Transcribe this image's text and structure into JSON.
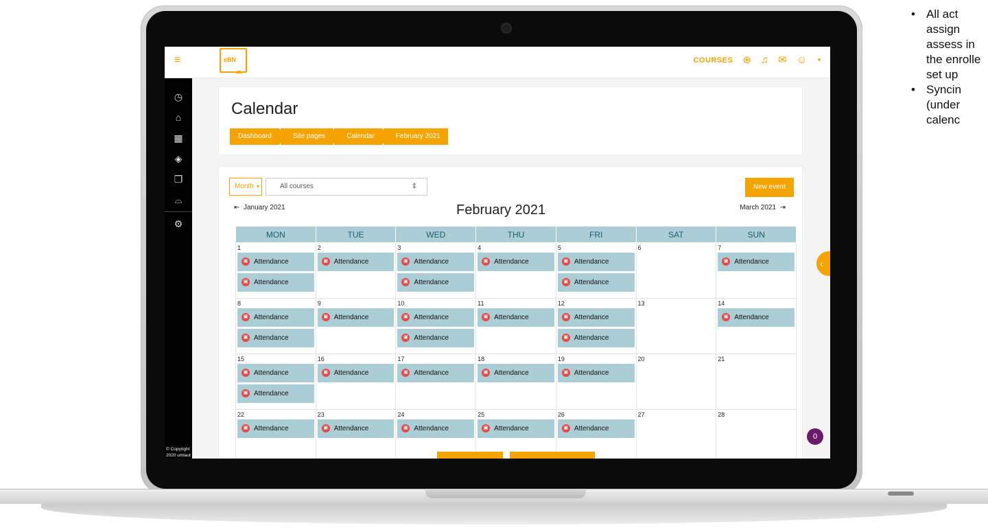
{
  "app": {
    "logo_text": "eBN",
    "top_nav": {
      "courses_label": "COURSES"
    },
    "copyright": "© Copyright 2020 umlaut"
  },
  "page": {
    "title": "Calendar",
    "breadcrumb": [
      "Dashboard",
      "Site pages",
      "Calendar",
      "February 2021"
    ]
  },
  "calendar": {
    "view_select": "Month",
    "course_filter": "All courses",
    "new_event_label": "New event",
    "prev_month": "January 2021",
    "next_month": "March 2021",
    "month_title": "February 2021",
    "weekdays": [
      "MON",
      "TUE",
      "WED",
      "THU",
      "FRI",
      "SAT",
      "SUN"
    ],
    "event_label": "Attendance",
    "weeks": [
      [
        {
          "day": "1",
          "events": 2
        },
        {
          "day": "2",
          "events": 1
        },
        {
          "day": "3",
          "events": 2
        },
        {
          "day": "4",
          "events": 1
        },
        {
          "day": "5",
          "events": 2
        },
        {
          "day": "6",
          "events": 0
        },
        {
          "day": "7",
          "events": 1
        }
      ],
      [
        {
          "day": "8",
          "events": 2
        },
        {
          "day": "9",
          "events": 1
        },
        {
          "day": "10",
          "events": 2
        },
        {
          "day": "11",
          "events": 1
        },
        {
          "day": "12",
          "events": 2
        },
        {
          "day": "13",
          "events": 0
        },
        {
          "day": "14",
          "events": 1
        }
      ],
      [
        {
          "day": "15",
          "events": 2
        },
        {
          "day": "16",
          "events": 1
        },
        {
          "day": "17",
          "events": 1
        },
        {
          "day": "18",
          "events": 1
        },
        {
          "day": "19",
          "events": 1
        },
        {
          "day": "20",
          "events": 0
        },
        {
          "day": "21",
          "events": 0
        }
      ],
      [
        {
          "day": "22",
          "events": 1
        },
        {
          "day": "23",
          "events": 1
        },
        {
          "day": "24",
          "events": 1
        },
        {
          "day": "25",
          "events": 1
        },
        {
          "day": "26",
          "events": 1
        },
        {
          "day": "27",
          "events": 0
        },
        {
          "day": "28",
          "events": 0
        }
      ]
    ]
  },
  "chat_badge": "0",
  "side_notes": [
    "All act assign assess in the enrolle set up",
    "Syncin (under calenc"
  ],
  "icons": {
    "sidebar": [
      "dashboard-icon",
      "home-icon",
      "calendar-icon",
      "layers-icon",
      "files-icon",
      "graduation-cap-icon",
      "settings-icon"
    ],
    "topbar": [
      "globe-icon",
      "bell-icon",
      "mail-icon",
      "user-icon",
      "caret-down-icon"
    ]
  },
  "colors": {
    "accent": "#f5a300",
    "event_bg": "#abcdd6",
    "event_dot": "#e34a4a",
    "sidebar_bg": "#000000"
  }
}
